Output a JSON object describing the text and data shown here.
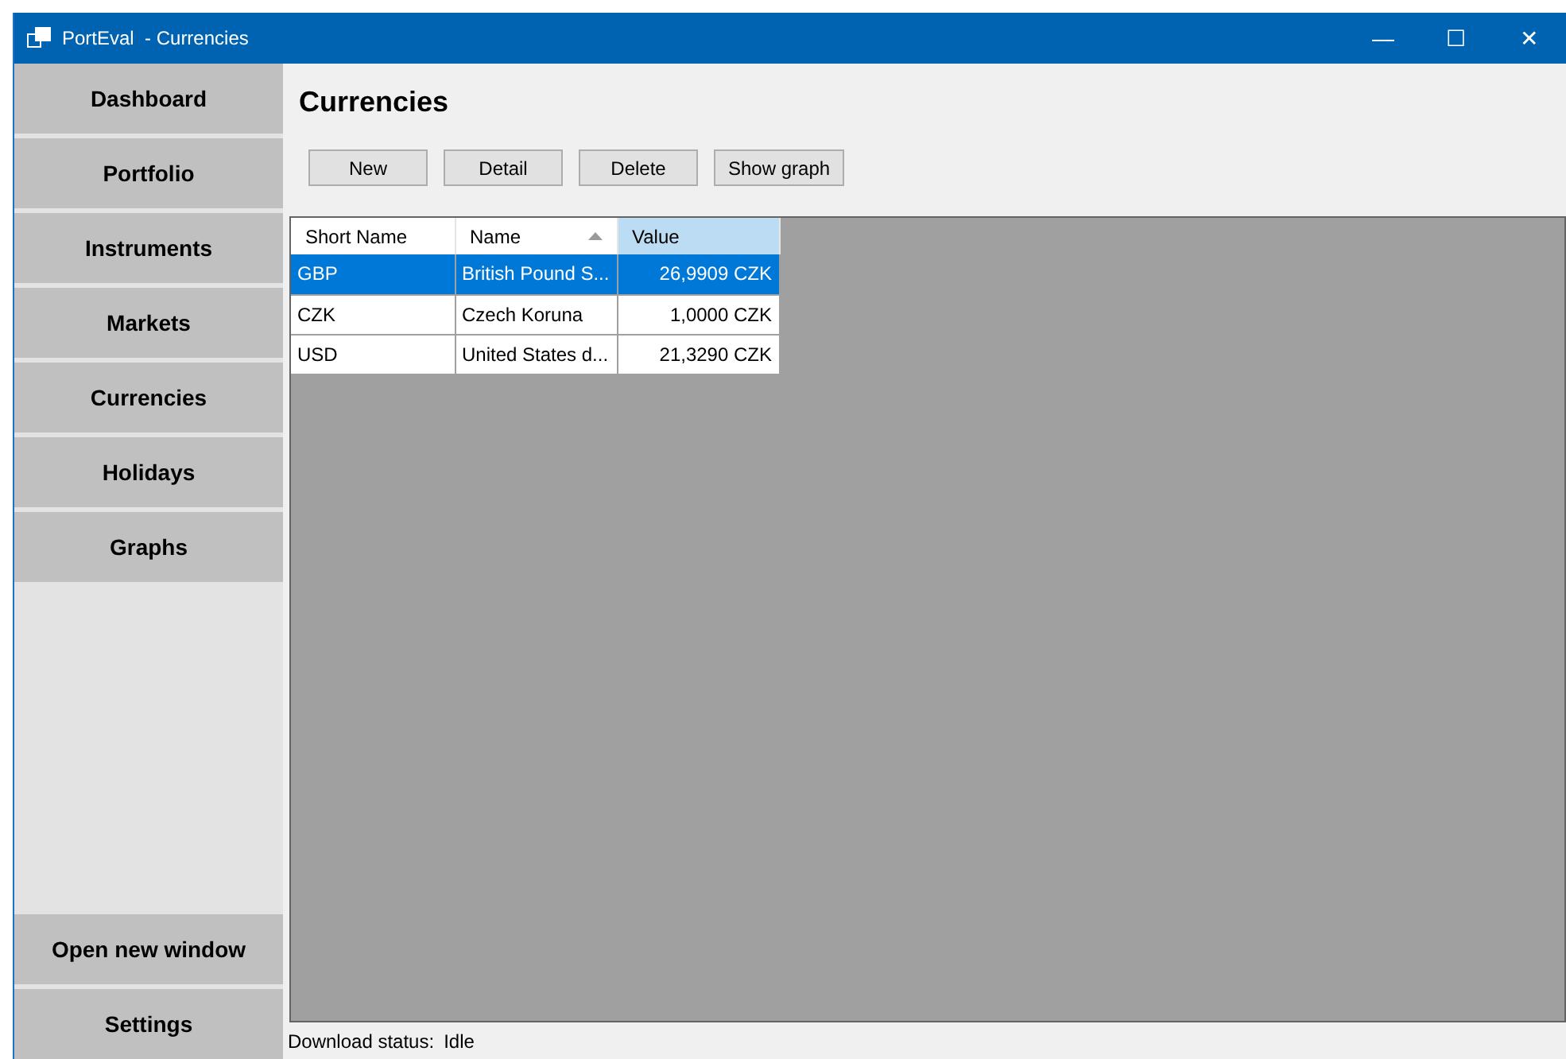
{
  "window": {
    "title": "PortEval  - Currencies",
    "controls": [
      "—",
      "☐",
      "✕"
    ]
  },
  "sidebar": {
    "items": [
      {
        "label": "Dashboard"
      },
      {
        "label": "Portfolio"
      },
      {
        "label": "Instruments"
      },
      {
        "label": "Markets"
      },
      {
        "label": "Currencies"
      },
      {
        "label": "Holidays"
      },
      {
        "label": "Graphs"
      }
    ],
    "bottom_items": [
      {
        "label": "Open new window"
      },
      {
        "label": "Settings"
      }
    ]
  },
  "page_title": "Currencies",
  "toolbar": [
    "New",
    "Detail",
    "Delete",
    "Show graph"
  ],
  "table": {
    "columns": [
      {
        "label": "Short Name",
        "sorted": false,
        "selected": false
      },
      {
        "label": "Name",
        "sorted": true,
        "selected": false
      },
      {
        "label": "Value",
        "sorted": false,
        "selected": true
      }
    ],
    "rows": [
      {
        "cells": [
          "GBP",
          "British Pound S...",
          "26,9909 CZK"
        ],
        "selected": true
      },
      {
        "cells": [
          "CZK",
          "Czech Koruna",
          "1,0000 CZK"
        ],
        "selected": false
      },
      {
        "cells": [
          "USD",
          "United States d...",
          "21,3290 CZK"
        ],
        "selected": false
      }
    ]
  },
  "status_bar": {
    "label": "Download status:",
    "value": "Idle"
  }
}
